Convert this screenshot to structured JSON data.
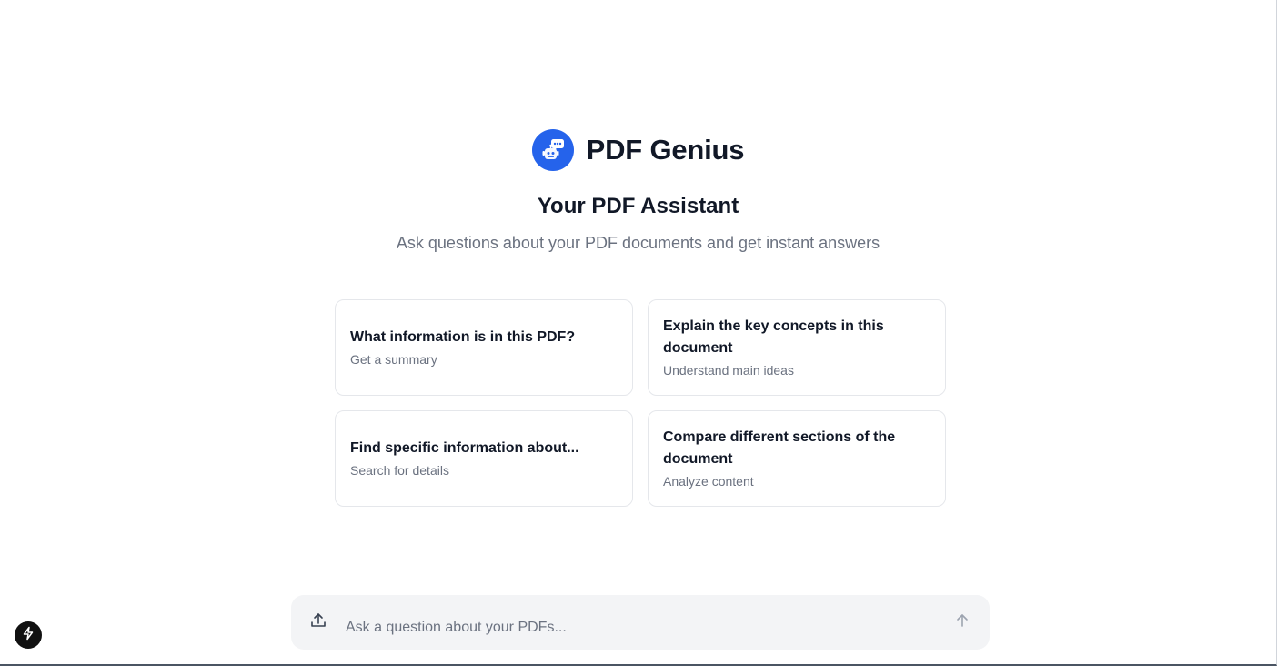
{
  "brand": {
    "name": "PDF Genius",
    "logo_icon": "robot-chat-icon",
    "accent_color": "#2563eb"
  },
  "hero": {
    "title": "Your PDF Assistant",
    "subtitle": "Ask questions about your PDF documents and get instant answers"
  },
  "suggestions": [
    {
      "title": "What information is in this PDF?",
      "subtitle": "Get a summary"
    },
    {
      "title": "Explain the key concepts in this document",
      "subtitle": "Understand main ideas"
    },
    {
      "title": "Find specific information about...",
      "subtitle": "Search for details"
    },
    {
      "title": "Compare different sections of the document",
      "subtitle": "Analyze content"
    }
  ],
  "composer": {
    "placeholder": "Ask a question about your PDFs...",
    "upload_icon": "upload-icon",
    "send_icon": "arrow-up-icon"
  },
  "floating": {
    "icon": "lightning-bolt-icon"
  }
}
